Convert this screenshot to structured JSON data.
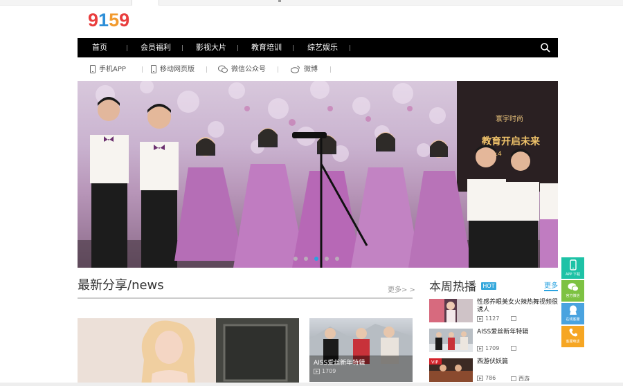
{
  "logo": {
    "chars": [
      "9",
      "1",
      "5",
      "9"
    ],
    "colors": [
      "#e93d3d",
      "#2e8fd8",
      "#f29a2e",
      "#e93d3d"
    ]
  },
  "nav": {
    "items": [
      "首页",
      "会员福利",
      "影视大片",
      "教育培训",
      "综艺娱乐"
    ],
    "search_icon": "search-icon"
  },
  "subbar": {
    "items": [
      {
        "label": "手机APP",
        "icon": "phone-icon"
      },
      {
        "label": "移动网页版",
        "icon": "mobile-icon"
      },
      {
        "label": "微信公众号",
        "icon": "wechat-icon"
      },
      {
        "label": "微博",
        "icon": "weibo-icon"
      }
    ]
  },
  "banner": {
    "sign_title": "教育开启未来",
    "sign_sub": "2014",
    "sign_logo": "寰宇时尚",
    "slides": 5,
    "active_slide": 3
  },
  "latest": {
    "title": "最新分享/news",
    "more": "更多> >",
    "small_card": {
      "title": "AISS爱丝新年特辑",
      "views": "1709"
    }
  },
  "hot": {
    "title": "本周热播",
    "badge": "HOT",
    "more": "更多",
    "items": [
      {
        "name": "性感养眼美女火辣热舞视频很诱人",
        "views": "1127",
        "cat": ""
      },
      {
        "name": "AISS爱丝新年特辑",
        "views": "1709",
        "cat": ""
      },
      {
        "name": "西游伏妖篇",
        "views": "786",
        "cat": "西游",
        "tag": "VIP"
      }
    ]
  },
  "side": {
    "buttons": [
      {
        "label": "APP 下载",
        "color": "#1ec2a6",
        "icon": "phone-icon"
      },
      {
        "label": "官方微信",
        "color": "#7dc242",
        "icon": "wechat-icon"
      },
      {
        "label": "在线客服",
        "color": "#4aa3df",
        "icon": "chat-icon"
      },
      {
        "label": "客服电话",
        "color": "#f6a623",
        "icon": "telephone-icon"
      }
    ]
  }
}
